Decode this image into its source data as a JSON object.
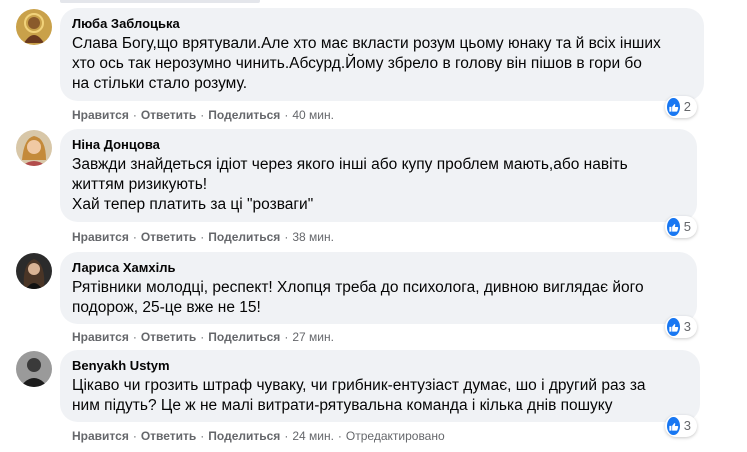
{
  "comments": [
    {
      "author": "Люба Заблоцька",
      "text": "Слава Богу,що врятували.Але хто має вкласти розум цьому юнаку та й всіх інших\nхто ось так нерозумно чинить.Абсурд.Йому збрело в голову він пішов в гори бо\nна стільки стало розуму.",
      "like_label": "Нравится",
      "reply_label": "Ответить",
      "share_label": "Поделиться",
      "time": "40 мин.",
      "reaction_count": "2"
    },
    {
      "author": "Ніна Донцова",
      "text": "Завжди знайдеться ідіот через якого інші або купу проблем мають,або навіть\nжиттям ризикують!\nХай тепер платить за ці \"розваги\"",
      "like_label": "Нравится",
      "reply_label": "Ответить",
      "share_label": "Поделиться",
      "time": "38 мин.",
      "reaction_count": "5"
    },
    {
      "author": "Лариса Хамхіль",
      "text": "Рятівники молодці, респект! Хлопця треба до психолога, дивною виглядає його\nподорож, 25-це вже не 15!",
      "like_label": "Нравится",
      "reply_label": "Ответить",
      "share_label": "Поделиться",
      "time": "27 мин.",
      "reaction_count": "3"
    },
    {
      "author": "Benyakh Ustym",
      "text": "Цікаво чи грозить штраф чуваку, чи грибник-ентузіаст думає, шо і другий раз за\nним підуть? Це ж не малі витрати-рятувальна команда і кілька днів пошуку",
      "like_label": "Нравится",
      "reply_label": "Ответить",
      "share_label": "Поделиться",
      "time": "24 мин.",
      "edited": "Отредактировано",
      "reaction_count": "3"
    }
  ],
  "colors": {
    "bubble_bg": "#f0f2f5",
    "meta_text": "#65676b",
    "like_blue": "#1877f2"
  },
  "icons": {
    "reaction": "like-thumb-icon",
    "separator": "·"
  }
}
